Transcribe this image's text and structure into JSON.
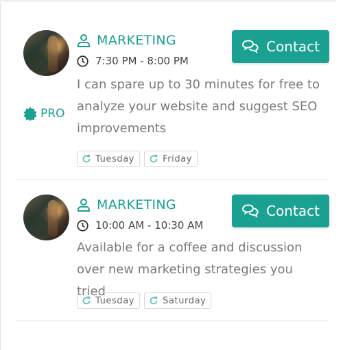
{
  "colors": {
    "accent": "#1aa191",
    "text": "#7a7a7a",
    "dark_text": "#444444"
  },
  "cards": [
    {
      "pro_label": "PRO",
      "category": "MARKETING",
      "time": "7:30 PM - 8:00 PM",
      "description": "I can spare up to 30 minutes for free to analyze your website and suggest SEO improvements",
      "contact_label": "Contact",
      "days": [
        "Tuesday",
        "Friday"
      ]
    },
    {
      "category": "MARKETING",
      "time": "10:00 AM - 10:30 AM",
      "description": "Available for a coffee and discussion over new marketing strategies you tried",
      "contact_label": "Contact",
      "days": [
        "Tuesday",
        "Saturday"
      ]
    }
  ]
}
